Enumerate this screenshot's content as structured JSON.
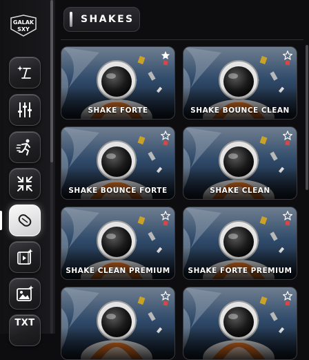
{
  "sidebar": {
    "logo_text": "GALAK SXY",
    "tools": [
      {
        "name": "magic-text-tool",
        "icon": "sparkle-text-icon"
      },
      {
        "name": "adjust-tool",
        "icon": "sliders-icon"
      },
      {
        "name": "motion-tool",
        "icon": "running-person-icon"
      },
      {
        "name": "zoom-tool",
        "icon": "compress-arrows-icon"
      },
      {
        "name": "shakes-tool",
        "icon": "capsule-icon",
        "active": true
      },
      {
        "name": "video-effects-tool",
        "icon": "film-sparkle-icon"
      },
      {
        "name": "image-tool",
        "icon": "image-sparkle-icon"
      },
      {
        "name": "text-tool",
        "icon": "txt-icon",
        "label": "TXT"
      }
    ]
  },
  "header": {
    "title": "SHAKES"
  },
  "presets": [
    {
      "title": "SHAKE FORTE",
      "favorited": true
    },
    {
      "title": "SHAKE BOUNCE CLEAN",
      "favorited": false
    },
    {
      "title": "SHAKE BOUNCE FORTE",
      "favorited": false
    },
    {
      "title": "SHAKE CLEAN",
      "favorited": false
    },
    {
      "title": "SHAKE CLEAN PREMIUM",
      "favorited": false
    },
    {
      "title": "SHAKE FORTE PREMIUM",
      "favorited": false
    },
    {
      "title": "",
      "favorited": false
    },
    {
      "title": "",
      "favorited": false
    }
  ],
  "colors": {
    "background": "#0d0d0f",
    "sidebar": "#17171a",
    "accent": "#ffffff",
    "space_blue": "#1e3a5c",
    "suit_orange": "#d2691e"
  }
}
